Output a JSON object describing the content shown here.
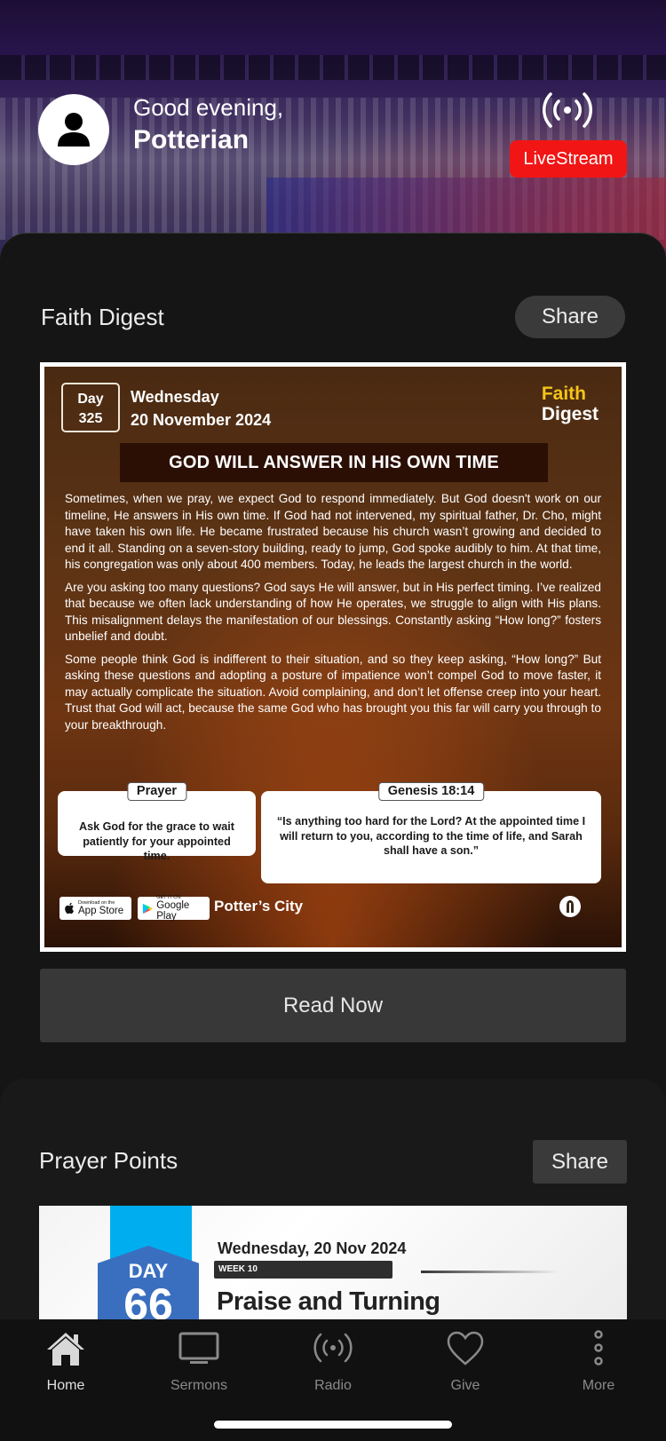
{
  "header": {
    "greeting": "Good evening,",
    "username": "Potterian",
    "livestream_label": "LiveStream",
    "accent_color": "#f21515"
  },
  "faith_digest": {
    "section_title": "Faith Digest",
    "share_label": "Share",
    "read_now_label": "Read Now",
    "image": {
      "day_label": "Day",
      "day_number": "325",
      "weekday": "Wednesday",
      "date": "20 November 2024",
      "brand_line1": "Faith",
      "brand_line2": "Digest",
      "headline": "GOD WILL ANSWER IN HIS OWN TIME",
      "paragraphs": [
        "Sometimes, when we pray, we expect God to respond immediately. But God doesn't work on our timeline, He answers in His own time. If God had not intervened, my spiritual father, Dr. Cho, might have taken his own life. He became frustrated because his church wasn’t growing and decided to end it all. Standing on a seven-story building, ready to jump, God spoke audibly to him. At that time, his congregation was only about 400 members. Today, he leads the largest church in the world.",
        "Are you asking too many questions? God says He will answer, but in His perfect timing. I’ve realized that because we often lack understanding of how He operates, we struggle to align with His plans. This misalignment delays the manifestation of our blessings. Constantly asking “How long?” fosters unbelief and doubt.",
        "Some people think God is indifferent to their situation, and so they keep asking, “How long?” But asking these questions and adopting a posture of impatience won’t compel God to move faster, it may actually complicate the situation. Avoid complaining, and don’t let offense creep into your heart. Trust that God will act, because the same God who has brought you this far will carry you through to your breakthrough."
      ],
      "prayer_label": "Prayer",
      "prayer_text": "Ask God for the grace to wait patiently for your appointed time.",
      "scripture_label": "Genesis 18:14",
      "scripture_text": "“Is anything too hard for the Lord? At the appointed time I will return to you, according to the time of life, and Sarah shall have a son.”",
      "app_store_small": "Download on the",
      "app_store_big": "App Store",
      "google_play_small": "GET IT ON",
      "google_play_big": "Google Play",
      "footer_brand": "Potter’s City"
    }
  },
  "prayer_points": {
    "section_title": "Prayer Points",
    "share_label": "Share",
    "image": {
      "day_label": "DAY",
      "day_number": "66",
      "date": "Wednesday, 20 Nov 2024",
      "week": "WEEK 10",
      "title": "Praise and Turning"
    }
  },
  "tabbar": {
    "items": [
      {
        "label": "Home",
        "icon": "home-icon",
        "active": true
      },
      {
        "label": "Sermons",
        "icon": "tv-icon",
        "active": false
      },
      {
        "label": "Radio",
        "icon": "broadcast-icon",
        "active": false
      },
      {
        "label": "Give",
        "icon": "heart-icon",
        "active": false
      },
      {
        "label": "More",
        "icon": "more-vertical-icon",
        "active": false
      }
    ]
  }
}
